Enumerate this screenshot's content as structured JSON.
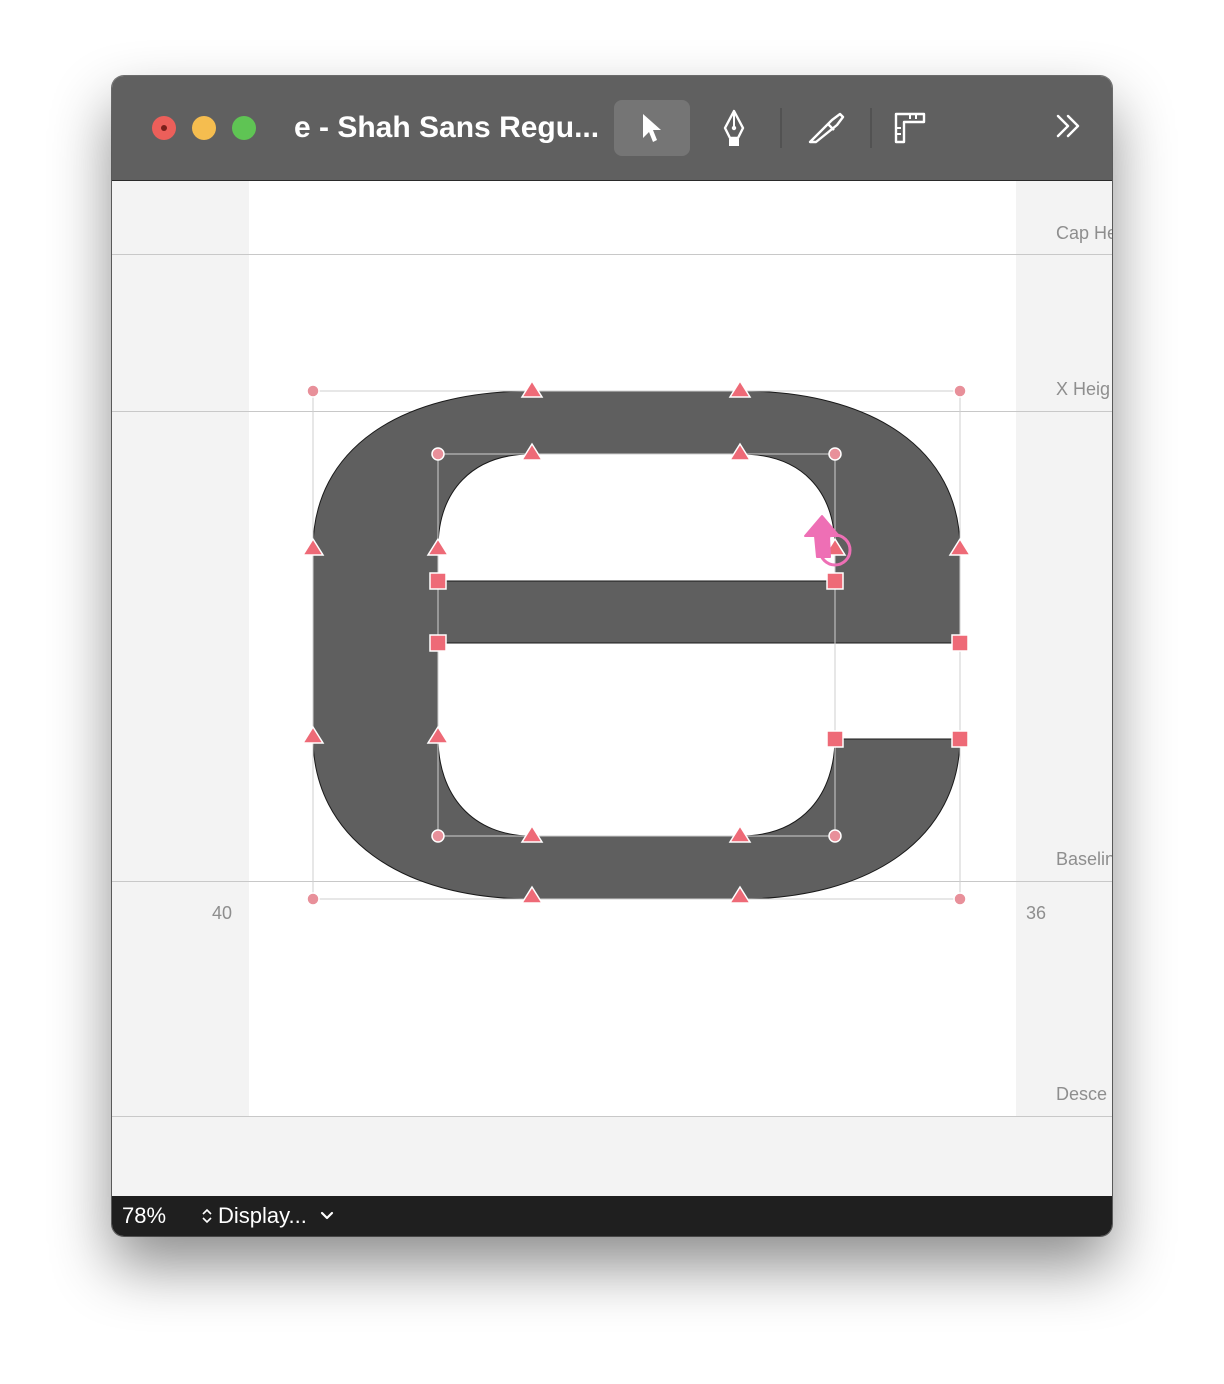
{
  "window": {
    "title": "e - Shah Sans Regu...",
    "traffic_lights": {
      "close": "#ec5f5a",
      "minimize": "#f5bd4f",
      "maximize": "#5fc454"
    }
  },
  "toolbar": {
    "tools": [
      {
        "name": "select-tool",
        "icon": "arrow-cursor-icon",
        "active": true
      },
      {
        "name": "pen-tool",
        "icon": "pen-nib-icon",
        "active": false
      },
      {
        "name": "knife-tool",
        "icon": "knife-icon",
        "active": false
      },
      {
        "name": "ruler-tool",
        "icon": "ruler-icon",
        "active": false
      }
    ],
    "overflow_icon": "double-chevron-right-icon"
  },
  "metrics": {
    "cap_height": "Cap He",
    "x_height": "X Heig",
    "baseline": "Baselin",
    "descender": "Desce"
  },
  "sidebearings": {
    "left": "40",
    "right": "36"
  },
  "colors": {
    "glyph_fill": "#5f5f5f",
    "node_color": "#ee6a77",
    "cursor_color": "#ee6fb5"
  },
  "status_bar": {
    "zoom": "78%",
    "display_menu": "Display..."
  }
}
